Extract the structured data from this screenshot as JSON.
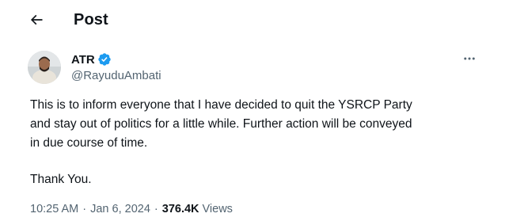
{
  "header": {
    "back_icon": "arrow-left-icon",
    "title": "Post"
  },
  "author": {
    "name": "ATR",
    "handle": "@RayuduAmbati",
    "verified": true,
    "verified_color": "#1d9bf0"
  },
  "post": {
    "lines": [
      "This is to inform everyone that I have decided to quit the YSRCP Party",
      "and stay out of politics for a little while. Further action will be conveyed",
      "in due course of time."
    ],
    "signoff": "Thank You.",
    "time": "10:25 AM",
    "date": "Jan 6, 2024",
    "views_count": "376.4K",
    "views_label": "Views",
    "separator": "·"
  },
  "icons": {
    "more": "more-horizontal-icon"
  }
}
